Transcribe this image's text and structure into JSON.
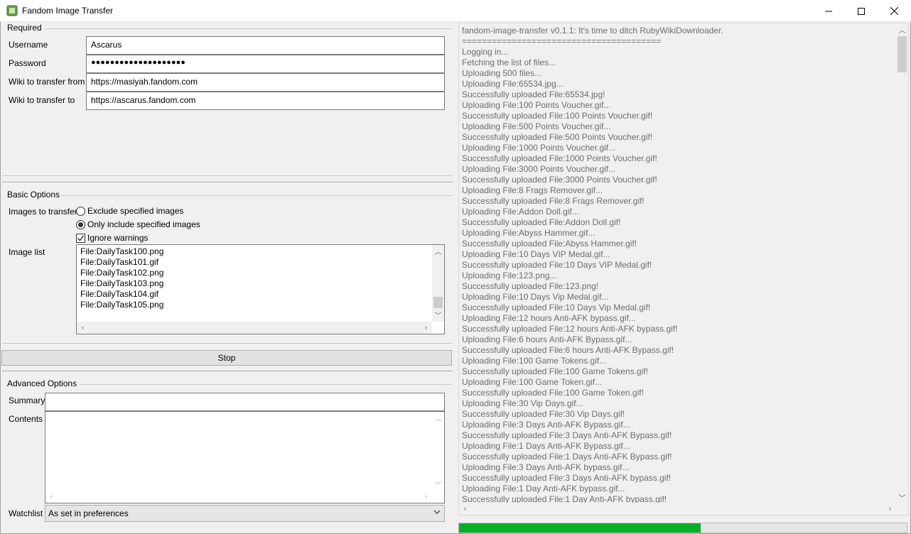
{
  "window": {
    "title": "Fandom Image Transfer",
    "icon": "fandom-app-icon",
    "controls": [
      "minimize-icon",
      "maximize-icon",
      "close-icon"
    ]
  },
  "required": {
    "title": "Required",
    "username_label": "Username",
    "username_value": "Ascarus",
    "password_label": "Password",
    "password_value": "●●●●●●●●●●●●●●●●●●●●",
    "wiki_from_label": "Wiki to transfer from",
    "wiki_from_value": "https://masiyah.fandom.com",
    "wiki_to_label": "Wiki to transfer to",
    "wiki_to_value": "https://ascarus.fandom.com"
  },
  "basic": {
    "title": "Basic Options",
    "images_label": "Images to transfer",
    "radio_exclude": "Exclude specified images",
    "radio_include": "Only include specified images",
    "selected_mode": "include",
    "ignore_warnings_label": "Ignore warnings",
    "ignore_warnings_checked": true,
    "image_list_label": "Image list",
    "image_list": [
      "File:DailyTask100.png",
      "File:DailyTask101.gif",
      "File:DailyTask102.png",
      "File:DailyTask103.png",
      "File:DailyTask104.gif",
      "File:DailyTask105.png"
    ]
  },
  "stop_button": "Stop",
  "advanced": {
    "title": "Advanced Options",
    "summary_label": "Summary",
    "summary_value": "",
    "contents_label": "Contents",
    "contents_value": "",
    "watchlist_label": "Watchlist",
    "watchlist_value": "As set in preferences"
  },
  "log": {
    "lines": [
      "fandom-image-transfer v0.1.1: It's time to ditch RubyWikiDownloader.",
      "========================================",
      "Logging in...",
      "Fetching the list of files...",
      "Uploading 500 files...",
      "Uploading File:65534.jpg...",
      "Successfully uploaded File:65534.jpg!",
      "Uploading File:100 Points Voucher.gif...",
      "Successfully uploaded File:100 Points Voucher.gif!",
      "Uploading File:500 Points Voucher.gif...",
      "Successfully uploaded File:500 Points Voucher.gif!",
      "Uploading File:1000 Points Voucher.gif...",
      "Successfully uploaded File:1000 Points Voucher.gif!",
      "Uploading File:3000 Points Voucher.gif...",
      "Successfully uploaded File:3000 Points Voucher.gif!",
      "Uploading File:8 Frags Remover.gif...",
      "Successfully uploaded File:8 Frags Remover.gif!",
      "Uploading File:Addon Doll.gif...",
      "Successfully uploaded File:Addon Doll.gif!",
      "Uploading File:Abyss Hammer.gif...",
      "Successfully uploaded File:Abyss Hammer.gif!",
      "Uploading File:10 Days VIP Medal.gif...",
      "Successfully uploaded File:10 Days VIP Medal.gif!",
      "Uploading File:123.png...",
      "Successfully uploaded File:123.png!",
      "Uploading File:10 Days Vip Medal.gif...",
      "Successfully uploaded File:10 Days Vip Medal.gif!",
      "Uploading File:12 hours Anti-AFK bypass.gif...",
      "Successfully uploaded File:12 hours Anti-AFK bypass.gif!",
      "Uploading File:6 hours Anti-AFK Bypass.gif...",
      "Successfully uploaded File:6 hours Anti-AFK Bypass.gif!",
      "Uploading File:100 Game Tokens.gif...",
      "Successfully uploaded File:100 Game Tokens.gif!",
      "Uploading File:100 Game Token.gif...",
      "Successfully uploaded File:100 Game Token.gif!",
      "Uploading File:30 Vip Days.gif...",
      "Successfully uploaded File:30 Vip Days.gif!",
      "Uploading File:3 Days Anti-AFK Bypass.gif...",
      "Successfully uploaded File:3 Days Anti-AFK Bypass.gif!",
      "Uploading File:1 Days Anti-AFK Bypass.gif...",
      "Successfully uploaded File:1 Days Anti-AFK Bypass.gif!",
      "Uploading File:3 Days Anti-AFK bypass.gif...",
      "Successfully uploaded File:3 Days Anti-AFK bypass.gif!",
      "Uploading File:1 Day Anti-AFK bypass.gif...",
      "Successfully uploaded File:1 Day Anti-AFK bypass.gif!"
    ]
  },
  "progress": {
    "fraction": 0.54,
    "color": "#06b025"
  }
}
